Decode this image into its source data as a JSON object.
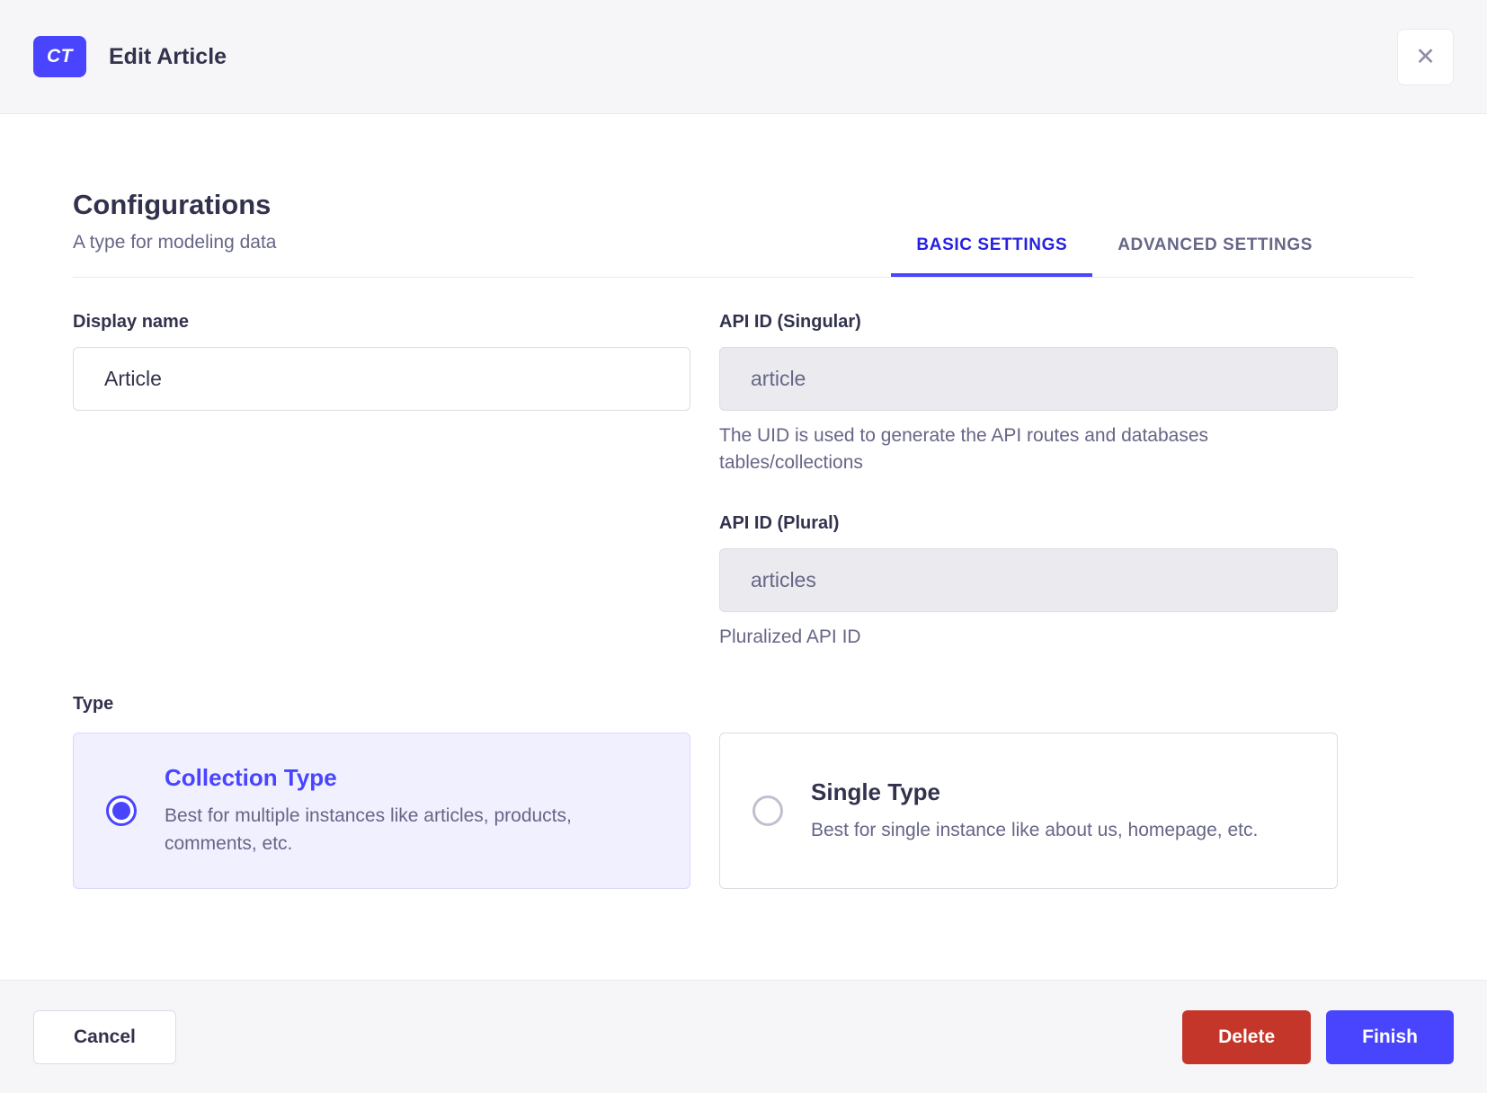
{
  "header": {
    "badge_label": "CT",
    "title": "Edit Article",
    "close_icon": "✕"
  },
  "config": {
    "title": "Configurations",
    "subtitle": "A type for modeling data"
  },
  "tabs": [
    {
      "label": "BASIC SETTINGS",
      "active": true
    },
    {
      "label": "ADVANCED SETTINGS",
      "active": false
    }
  ],
  "fields": {
    "display_name": {
      "label": "Display name",
      "value": "Article"
    },
    "api_id_singular": {
      "label": "API ID (Singular)",
      "value": "article",
      "help": "The UID is used to generate the API routes and databases tables/collections"
    },
    "api_id_plural": {
      "label": "API ID (Plural)",
      "value": "articles",
      "help": "Pluralized API ID"
    }
  },
  "type_section": {
    "label": "Type",
    "options": [
      {
        "title": "Collection Type",
        "description": "Best for multiple instances like articles, products, comments, etc.",
        "selected": true
      },
      {
        "title": "Single Type",
        "description": "Best for single instance like about us, homepage, etc.",
        "selected": false
      }
    ]
  },
  "footer": {
    "cancel_label": "Cancel",
    "delete_label": "Delete",
    "finish_label": "Finish"
  },
  "colors": {
    "primary": "#4945ff",
    "primary_text": "#271fe0",
    "primary_light_bg": "#f0f0ff",
    "danger": "#c5362a",
    "text_dark": "#32324d",
    "text_muted": "#666687",
    "surface_gray": "#f6f6f9"
  }
}
